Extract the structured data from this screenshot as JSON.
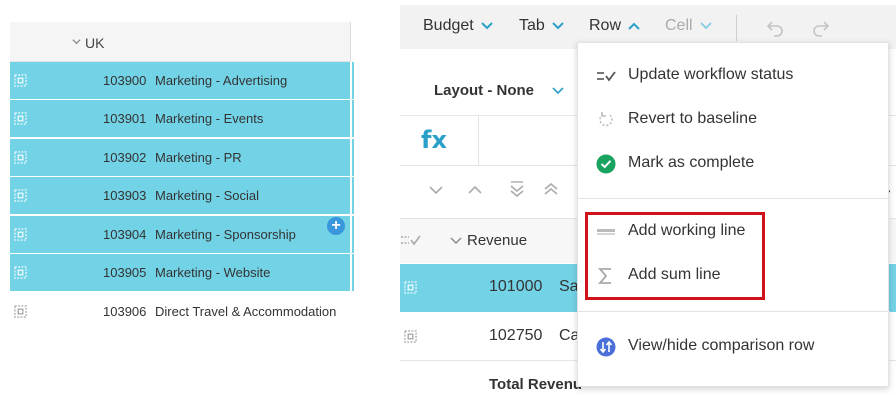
{
  "left_panel": {
    "group_label": "UK",
    "rows": [
      {
        "code": "103900",
        "desc": "Marketing - Advertising",
        "selected": true
      },
      {
        "code": "103901",
        "desc": "Marketing - Events",
        "selected": true
      },
      {
        "code": "103902",
        "desc": "Marketing - PR",
        "selected": true
      },
      {
        "code": "103903",
        "desc": "Marketing - Social",
        "selected": true
      },
      {
        "code": "103904",
        "desc": "Marketing - Sponsorship",
        "selected": true
      },
      {
        "code": "103905",
        "desc": "Marketing - Website",
        "selected": true
      },
      {
        "code": "103906",
        "desc": "Direct Travel & Accommodation",
        "selected": false
      }
    ],
    "add_button": "+"
  },
  "toolbar": {
    "budget": "Budget",
    "tab": "Tab",
    "row": "Row",
    "cell": "Cell"
  },
  "layout": {
    "label": "Layout - None"
  },
  "formula": {
    "fx": "fx"
  },
  "grid": {
    "header_label": "Revenue",
    "rows": [
      {
        "code": "101000",
        "desc": "Sal",
        "selected": true
      },
      {
        "code": "102750",
        "desc": "Ca",
        "selected": false
      }
    ],
    "total_label": "Total Revenu",
    "edge_mark": "›"
  },
  "menu": {
    "items": [
      {
        "label": "Update workflow status",
        "icon": "workflow-status-icon"
      },
      {
        "label": "Revert to baseline",
        "icon": "revert-icon"
      },
      {
        "label": "Mark as complete",
        "icon": "check-circle-icon"
      },
      {
        "label": "Add working line",
        "icon": "working-line-icon"
      },
      {
        "label": "Add sum line",
        "icon": "sigma-icon"
      },
      {
        "label": "View/hide comparison row",
        "icon": "comparison-toggle-icon"
      }
    ]
  },
  "colors": {
    "selected_row": "#73d3e6",
    "accent_blue": "#2aa0c8",
    "highlight_red": "#d0121b",
    "complete_green": "#1aa260",
    "comparison_blue": "#4a6fd8"
  }
}
